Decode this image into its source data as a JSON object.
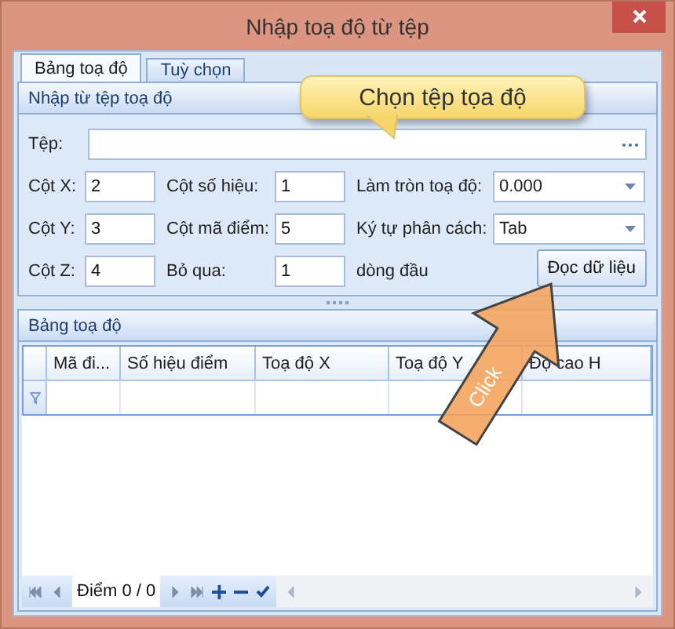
{
  "window": {
    "title": "Nhập toạ độ từ tệp"
  },
  "tabs": [
    {
      "label": "Bảng toạ độ",
      "selected": true
    },
    {
      "label": "Tuỳ chọn",
      "selected": false
    }
  ],
  "import_panel": {
    "title": "Nhập từ tệp toạ độ",
    "file_label": "Tệp:",
    "rows": [
      [
        {
          "kind": "input",
          "label": "Cột X:",
          "value": "2"
        },
        {
          "kind": "input",
          "label": "Cột số hiệu:",
          "value": "1"
        },
        {
          "kind": "combo",
          "label": "Làm tròn toạ độ:",
          "value": "0.000"
        }
      ],
      [
        {
          "kind": "input",
          "label": "Cột Y:",
          "value": "3"
        },
        {
          "kind": "input",
          "label": "Cột mã điểm:",
          "value": "5"
        },
        {
          "kind": "combo",
          "label": "Ký tự phân cách:",
          "value": "Tab"
        }
      ],
      [
        {
          "kind": "input",
          "label": "Cột Z:",
          "value": "4"
        },
        {
          "kind": "input",
          "label": "Bỏ qua:",
          "value": "1"
        },
        {
          "kind": "note",
          "label": "dòng đầu"
        }
      ]
    ],
    "read_button": "Đọc dữ liệu"
  },
  "grid_panel": {
    "title": "Bảng toạ độ",
    "columns": [
      "Mã đi...",
      "Số hiệu điểm",
      "Toạ độ X",
      "Toạ độ Y",
      "Độ cao H"
    ],
    "navigator": "Điểm 0 / 0"
  },
  "callout": {
    "text": "Chọn tệp tọa độ"
  },
  "click_arrow": {
    "text": "Click"
  }
}
